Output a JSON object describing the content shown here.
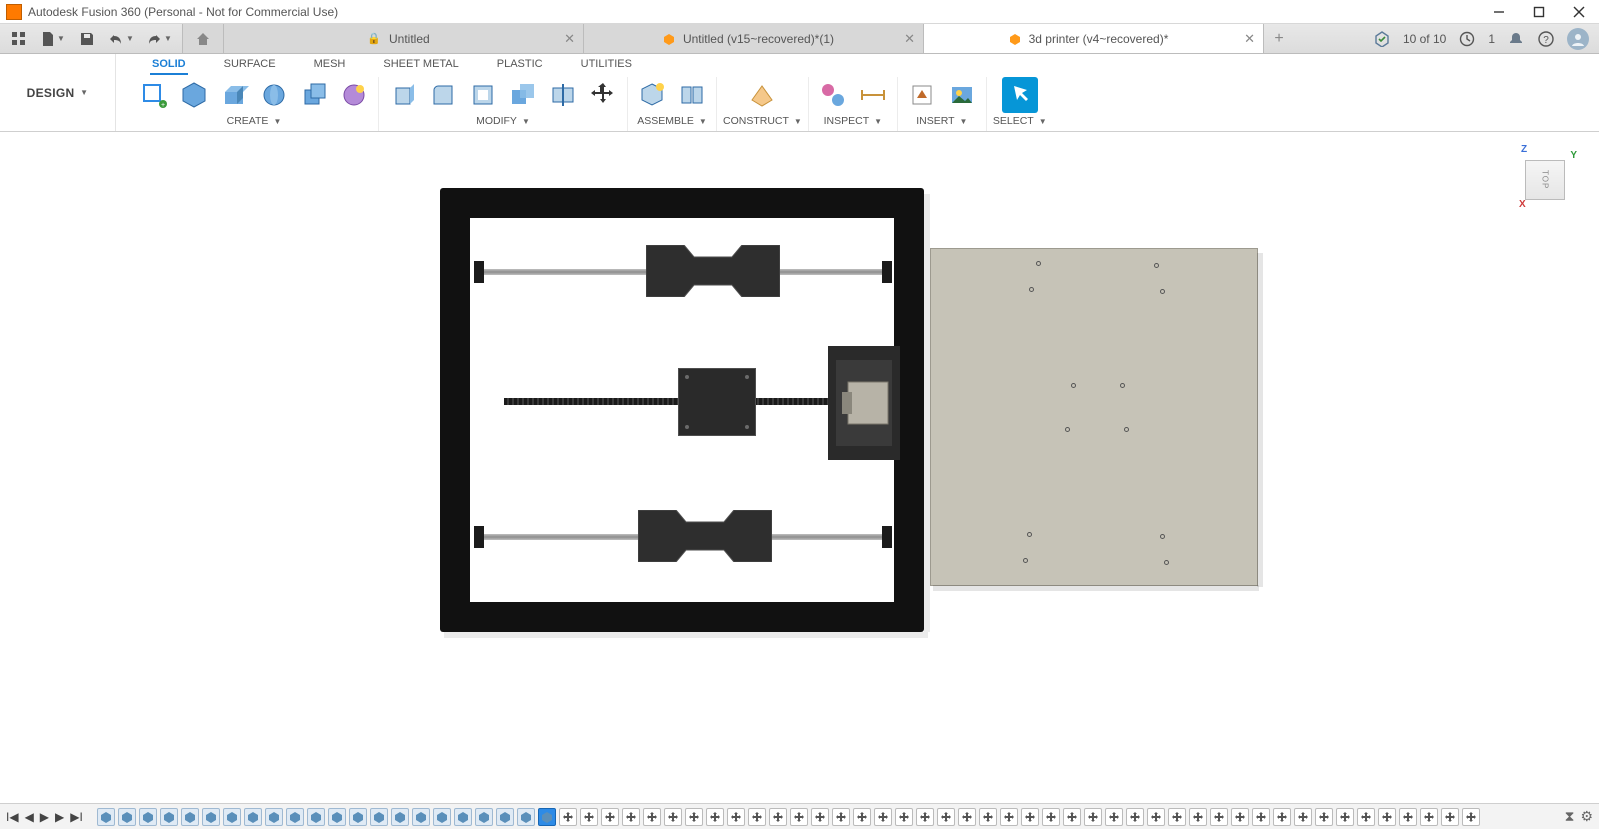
{
  "window": {
    "title": "Autodesk Fusion 360 (Personal - Not for Commercial Use)"
  },
  "qat": {
    "grid_icon": "grid",
    "file_icon": "file",
    "save_icon": "save",
    "undo_icon": "undo",
    "redo_icon": "redo"
  },
  "tabs": {
    "home_icon": "home",
    "items": [
      {
        "label": "Untitled",
        "locked": true,
        "recovered": false,
        "active": false
      },
      {
        "label": "Untitled (v15~recovered)*(1)",
        "locked": false,
        "recovered": true,
        "active": false
      },
      {
        "label": "3d printer (v4~recovered)*",
        "locked": false,
        "recovered": true,
        "active": true
      }
    ]
  },
  "status": {
    "jobs_icon": "jobs",
    "jobs_text": "10 of 10",
    "clock_icon": "clock",
    "clock_text": "1",
    "notify_icon": "bell",
    "help_icon": "help",
    "avatar_icon": "user"
  },
  "ribbon": {
    "design_label": "DESIGN",
    "tabs": [
      "SOLID",
      "SURFACE",
      "MESH",
      "SHEET METAL",
      "PLASTIC",
      "UTILITIES"
    ],
    "active_tab": "SOLID",
    "groups": {
      "create": "CREATE",
      "modify": "MODIFY",
      "assemble": "ASSEMBLE",
      "construct": "CONSTRUCT",
      "inspect": "INSPECT",
      "insert": "INSERT",
      "select": "SELECT"
    }
  },
  "viewcube": {
    "face": "TOP",
    "axes": {
      "z": "Z",
      "y": "Y",
      "x": "X"
    }
  },
  "timeline": {
    "nav": {
      "first": "first",
      "prev": "prev",
      "play": "play",
      "next": "next",
      "last": "last"
    }
  }
}
